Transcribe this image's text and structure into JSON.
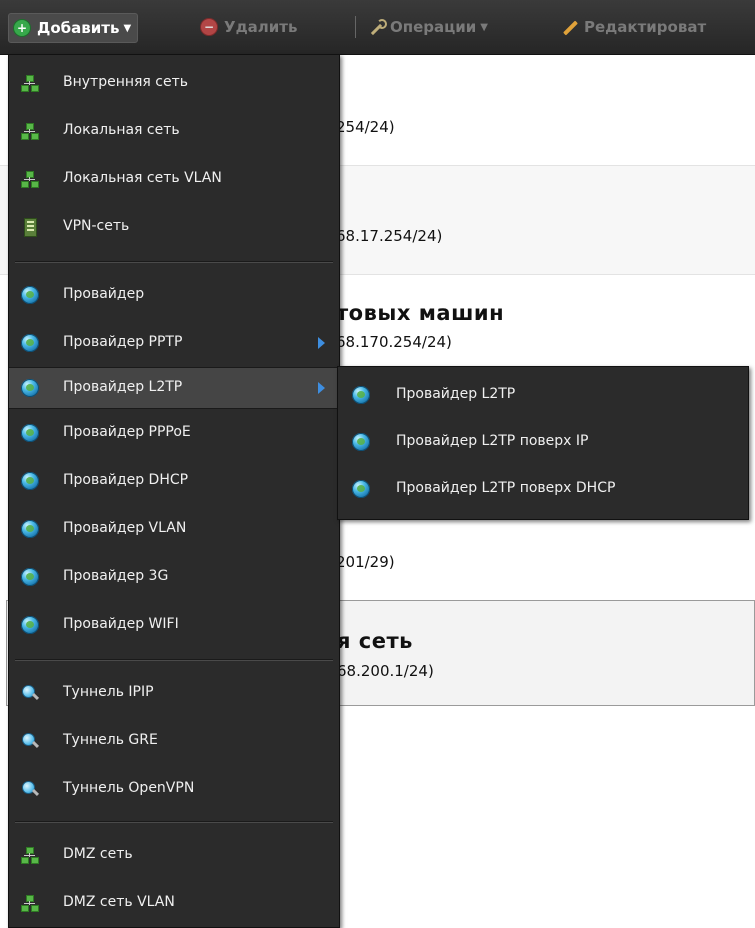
{
  "toolbar": {
    "add_label": "Добавить",
    "delete_label": "Удалить",
    "operations_label": "Операции",
    "edit_label": "Редактироват"
  },
  "background": {
    "row1_addr": "254/24)",
    "row2_addr": "68.17.254/24)",
    "row3_title": "товых машин",
    "row3_addr": "68.170.254/24)",
    "row4_addr": "201/29)",
    "row5_title": "я сеть",
    "row5_addr": "68.200.1/24)"
  },
  "add_menu": {
    "items": [
      {
        "label": "Внутренняя сеть",
        "icon": "network-icon"
      },
      {
        "label": "Локальная сеть",
        "icon": "network-icon"
      },
      {
        "label": "Локальная сеть VLAN",
        "icon": "network-icon"
      },
      {
        "label": "VPN-сеть",
        "icon": "vpn-icon"
      },
      {
        "label": "Провайдер",
        "icon": "globe-icon"
      },
      {
        "label": "Провайдер PPTP",
        "icon": "globe-icon",
        "has_submenu": true
      },
      {
        "label": "Провайдер L2TP",
        "icon": "globe-icon",
        "has_submenu": true,
        "active": true
      },
      {
        "label": "Провайдер PPPoE",
        "icon": "globe-icon"
      },
      {
        "label": "Провайдер DHCP",
        "icon": "globe-icon"
      },
      {
        "label": "Провайдер VLAN",
        "icon": "globe-icon"
      },
      {
        "label": "Провайдер 3G",
        "icon": "globe-icon"
      },
      {
        "label": "Провайдер WIFI",
        "icon": "globe-icon"
      },
      {
        "label": "Туннель IPIP",
        "icon": "tunnel-icon"
      },
      {
        "label": "Туннель GRE",
        "icon": "tunnel-icon"
      },
      {
        "label": "Туннель OpenVPN",
        "icon": "tunnel-icon"
      },
      {
        "label": "DMZ сеть",
        "icon": "network-icon"
      },
      {
        "label": "DMZ сеть VLAN",
        "icon": "network-icon"
      }
    ]
  },
  "l2tp_submenu": {
    "items": [
      {
        "label": "Провайдер L2TP",
        "icon": "globe-icon"
      },
      {
        "label": "Провайдер L2TP поверх IP",
        "icon": "globe-icon"
      },
      {
        "label": "Провайдер L2TP поверх DHCP",
        "icon": "globe-icon"
      }
    ]
  },
  "colors": {
    "menu_bg": "#2b2b2b",
    "menu_text": "#f0f0f0",
    "highlight_bg": "#454545",
    "submenu_arrow": "#3e8ee0",
    "toolbar_bg": "#2f2f2f"
  }
}
